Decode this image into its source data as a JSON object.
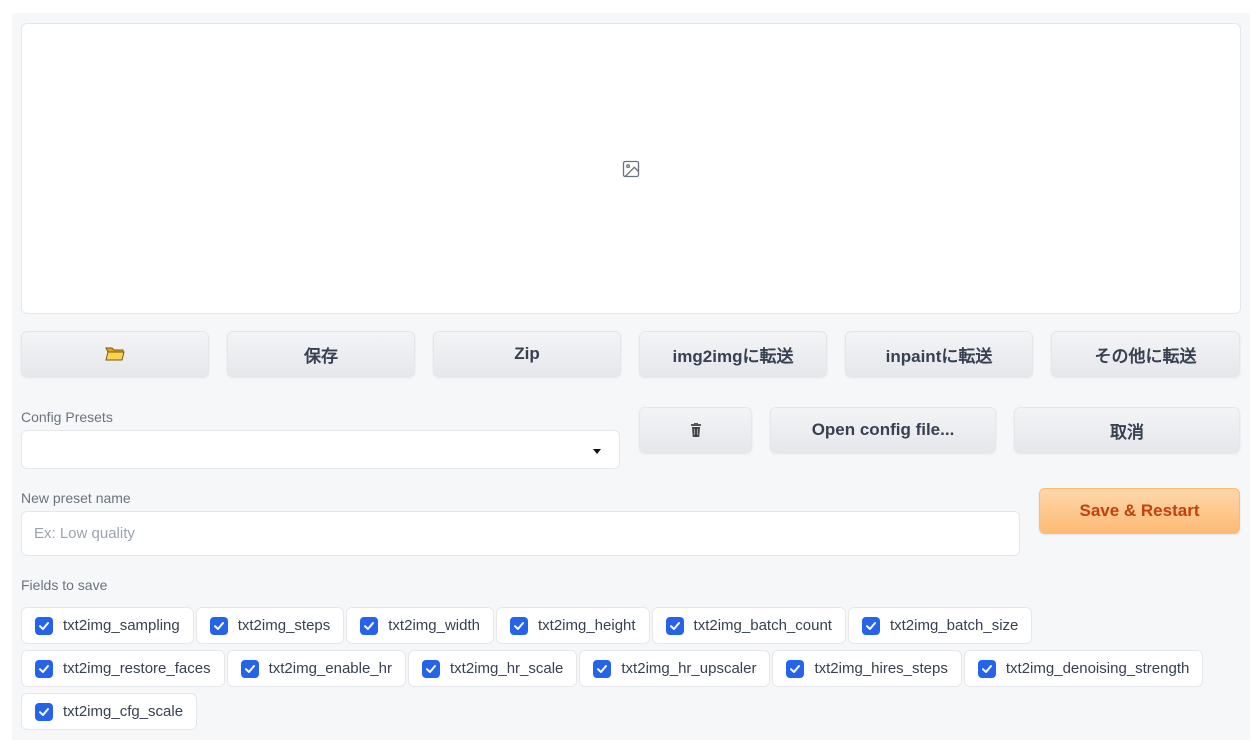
{
  "buttons": {
    "folder_icon": "folder-icon",
    "save": "保存",
    "zip": "Zip",
    "send_img2img": "img2imgに転送",
    "send_inpaint": "inpaintに転送",
    "send_other": "その他に転送",
    "trash_icon": "trash-icon",
    "open_config": "Open config file...",
    "cancel": "取消",
    "save_restart": "Save & Restart"
  },
  "config_presets": {
    "label": "Config Presets",
    "value": ""
  },
  "new_preset": {
    "label": "New preset name",
    "placeholder": "Ex: Low quality",
    "value": ""
  },
  "fields": {
    "label": "Fields to save",
    "row1": [
      "txt2img_sampling",
      "txt2img_steps",
      "txt2img_width",
      "txt2img_height",
      "txt2img_batch_count",
      "txt2img_batch_size"
    ],
    "row2": [
      "txt2img_restore_faces",
      "txt2img_enable_hr",
      "txt2img_hr_scale",
      "txt2img_hr_upscaler",
      "txt2img_hires_steps",
      "txt2img_denoising_strength"
    ],
    "row3": [
      "txt2img_cfg_scale"
    ],
    "checked": true
  },
  "colors": {
    "accent": "#2563eb",
    "primary_text": "#c2410c",
    "primary_bg": "#fdba74"
  }
}
